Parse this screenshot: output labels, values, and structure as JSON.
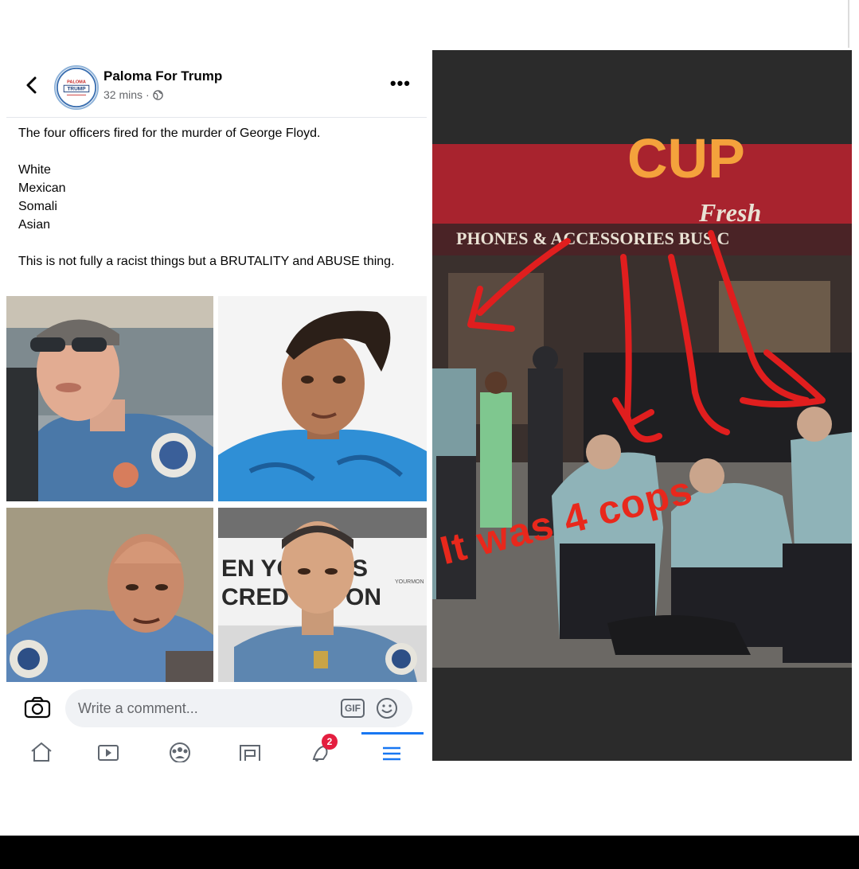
{
  "post": {
    "back_icon": "chevron-left-icon",
    "page_name": "Paloma For Trump",
    "avatar_lines": [
      "PALOMA",
      "TRUMP"
    ],
    "time": "32 mins",
    "separator": "·",
    "privacy_icon": "globe-icon",
    "more_label": "•••",
    "text_intro": "The four officers fired for the murder of George Floyd.",
    "list": [
      "White",
      "Mexican",
      "Somali",
      "Asian"
    ],
    "text_closing": "This is not fully a racist things but a BRUTALITY and ABUSE thing.",
    "photo4_sign_left": [
      "EN YC",
      "CRED"
    ],
    "photo4_sign_right": [
      "S",
      "ON"
    ],
    "photo4_sign_small": "YOURMON"
  },
  "comment_bar": {
    "camera_icon": "camera-icon",
    "placeholder": "Write a comment...",
    "gif_label": "GIF",
    "emoji_icon": "smiley-icon"
  },
  "bottom_nav": {
    "items": [
      "home-icon",
      "watch-icon",
      "groups-icon",
      "news-feed-icon",
      "notifications-icon",
      "menu-icon"
    ],
    "notification_count": "2",
    "active": "menu-icon"
  },
  "meme": {
    "sign_top": "CUP",
    "sign_fresh": "Fresh",
    "sign_row": "PHONES & ACCESSORIES  BUS C",
    "caption": "It was 4 cops",
    "colors": {
      "caption": "#e8281c",
      "awning": "#a8232e",
      "uniform": "#8fb3b8"
    }
  }
}
